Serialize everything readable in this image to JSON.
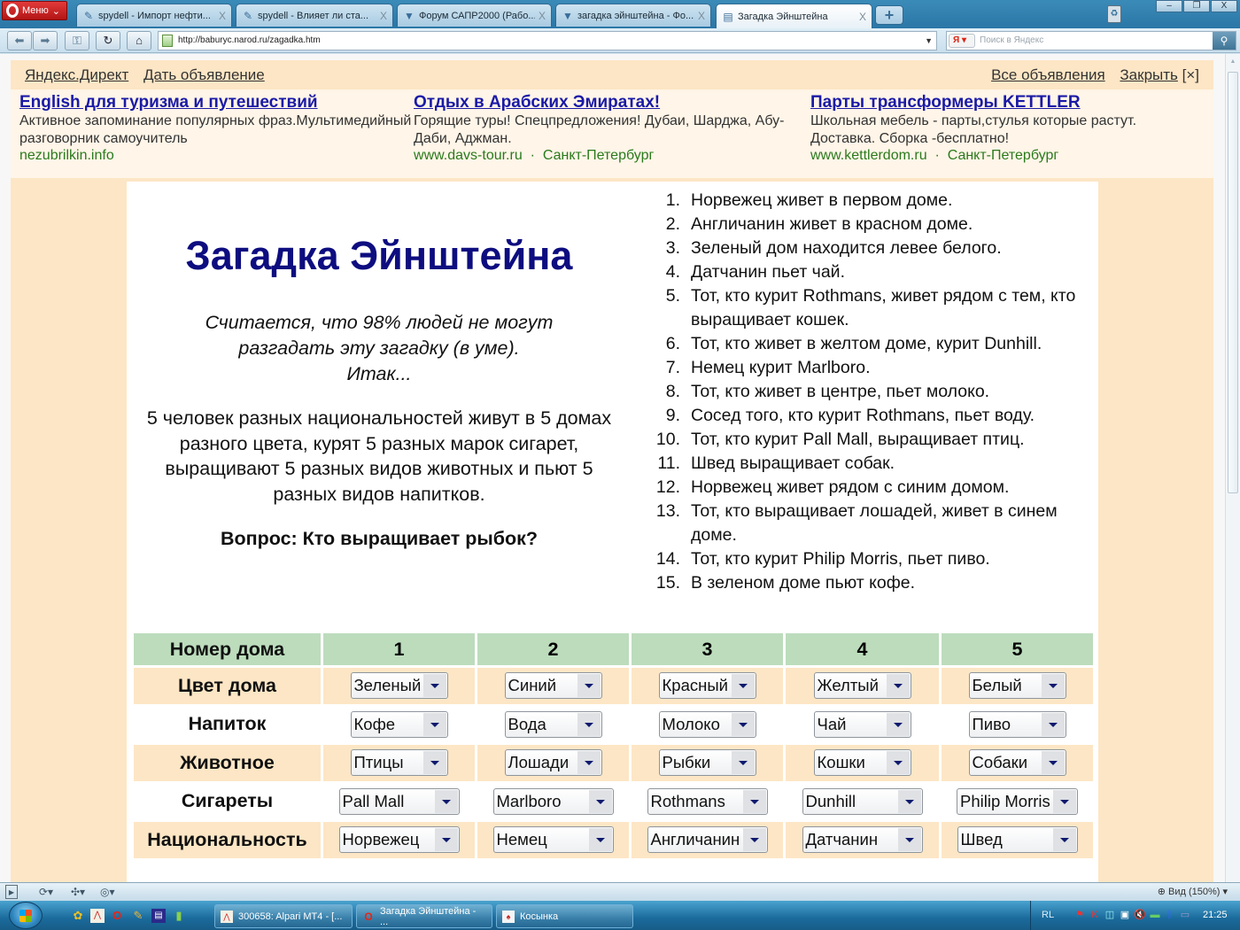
{
  "browser": {
    "menu_label": "Меню",
    "tabs": [
      {
        "label": "spydell - Импорт нефти...",
        "icon": "pencil-icon",
        "active": false
      },
      {
        "label": "spydell - Влияет ли ста...",
        "icon": "pencil-icon",
        "active": false
      },
      {
        "label": "Форум САПР2000 (Рабо...",
        "icon": "forum-icon",
        "active": false
      },
      {
        "label": "загадка эйнштейна - Фо...",
        "icon": "forum-icon",
        "active": false
      },
      {
        "label": "Загадка Эйнштейна",
        "icon": "page-icon",
        "active": true
      }
    ],
    "tab_close_glyph": "X",
    "new_tab_glyph": "+",
    "url": "http://baburyc.narod.ru/zagadka.htm",
    "search_placeholder": "Поиск в Яндекс",
    "search_engine_glyph": "Я",
    "window_buttons": [
      "–",
      "❐",
      "X"
    ]
  },
  "ads": {
    "top_left_links": [
      "Яндекс.Директ",
      "Дать объявление"
    ],
    "top_right_links": [
      "Все объявления",
      "Закрыть"
    ],
    "close_glyph": "[×]",
    "items": [
      {
        "title": "English для туризма и путешествий",
        "text": "Активное запоминание популярных фраз.Мультимедийный разговорник самоучитель",
        "url": "nezubrilkin.info",
        "city": ""
      },
      {
        "title": "Отдых в Арабских Эмиратах!",
        "text": "Горящие туры! Спецпредложения! Дубаи, Шарджа, Абу-Даби, Аджман.",
        "url": "www.davs-tour.ru",
        "city": "Санкт-Петербург"
      },
      {
        "title": "Парты трансформеры KETTLER",
        "text": "Школьная мебель - парты,стулья которые растут. Доставка. Сборка -бесплатно!",
        "url": "www.kettlerdom.ru",
        "city": "Санкт-Петербург"
      }
    ],
    "separator": "·"
  },
  "page": {
    "title": "Загадка Эйнштейна",
    "intro_lines": [
      "Считается, что 98% людей не могут",
      "разгадать эту загадку (в уме).",
      "Итак..."
    ],
    "description": "5 человек разных национальностей живут в 5 домах разного цвета, курят 5 разных марок сигарет, выращивают 5 разных видов животных и пьют 5 разных видов напитков.",
    "question": "Вопрос: Кто выращивает рыбок?",
    "rules": [
      {
        "num": "1.",
        "text": "Норвежец живет в первом доме."
      },
      {
        "num": "2.",
        "text": "Англичанин живет в красном доме."
      },
      {
        "num": "3.",
        "text": "Зеленый дом находится левее белого."
      },
      {
        "num": "4.",
        "text": "Датчанин пьет чай."
      },
      {
        "num": "5.",
        "text": "Тот, кто курит Rothmans, живет рядом с тем, кто"
      },
      {
        "num": "",
        "text": "выращивает кошек."
      },
      {
        "num": "6.",
        "text": "Тот, кто живет в желтом доме, курит Dunhill."
      },
      {
        "num": "7.",
        "text": "Немец курит Marlboro."
      },
      {
        "num": "8.",
        "text": "Тот, кто живет в центре, пьет молоко."
      },
      {
        "num": "9.",
        "text": "Сосед того, кто курит Rothmans, пьет воду."
      },
      {
        "num": "10.",
        "text": "Тот, кто курит Pall Mall, выращивает птиц."
      },
      {
        "num": "11.",
        "text": "Швед выращивает собак."
      },
      {
        "num": "12.",
        "text": "Норвежец живет рядом с синим домом."
      },
      {
        "num": "13.",
        "text": "Тот, кто выращивает лошадей, живет в синем доме."
      },
      {
        "num": "14.",
        "text": "Тот, кто курит Philip Morris, пьет пиво."
      },
      {
        "num": "15.",
        "text": "В зеленом доме пьют кофе."
      }
    ],
    "table": {
      "header": [
        "Номер дома",
        "1",
        "2",
        "3",
        "4",
        "5"
      ],
      "rows": [
        {
          "label": "Цвет дома",
          "values": [
            "Зеленый",
            "Синий",
            "Красный",
            "Желтый",
            "Белый"
          ]
        },
        {
          "label": "Напиток",
          "values": [
            "Кофе",
            "Вода",
            "Молоко",
            "Чай",
            "Пиво"
          ]
        },
        {
          "label": "Животное",
          "values": [
            "Птицы",
            "Лошади",
            "Рыбки",
            "Кошки",
            "Собаки"
          ]
        },
        {
          "label": "Сигареты",
          "values": [
            "Pall Mall",
            "Marlboro",
            "Rothmans",
            "Dunhill",
            "Philip Morris"
          ]
        },
        {
          "label": "Национальность",
          "values": [
            "Норвежец",
            "Немец",
            "Англичанин",
            "Датчанин",
            "Швед"
          ]
        }
      ]
    }
  },
  "statusbar": {
    "zoom_label": "Вид (150%)"
  },
  "taskbar": {
    "tasks": [
      {
        "label": "300658: Alpari MT4 - [..."
      },
      {
        "label": "Загадка Эйнштейна - ..."
      },
      {
        "label": "Косынка"
      }
    ],
    "language": "RL",
    "clock": "21:25"
  },
  "colors": {
    "title": "#0d0d80",
    "ad_link": "#1a1aa6",
    "ad_url": "#2a7a1c",
    "page_bg": "#fde6c5",
    "header_row": "#bcdcbc"
  }
}
